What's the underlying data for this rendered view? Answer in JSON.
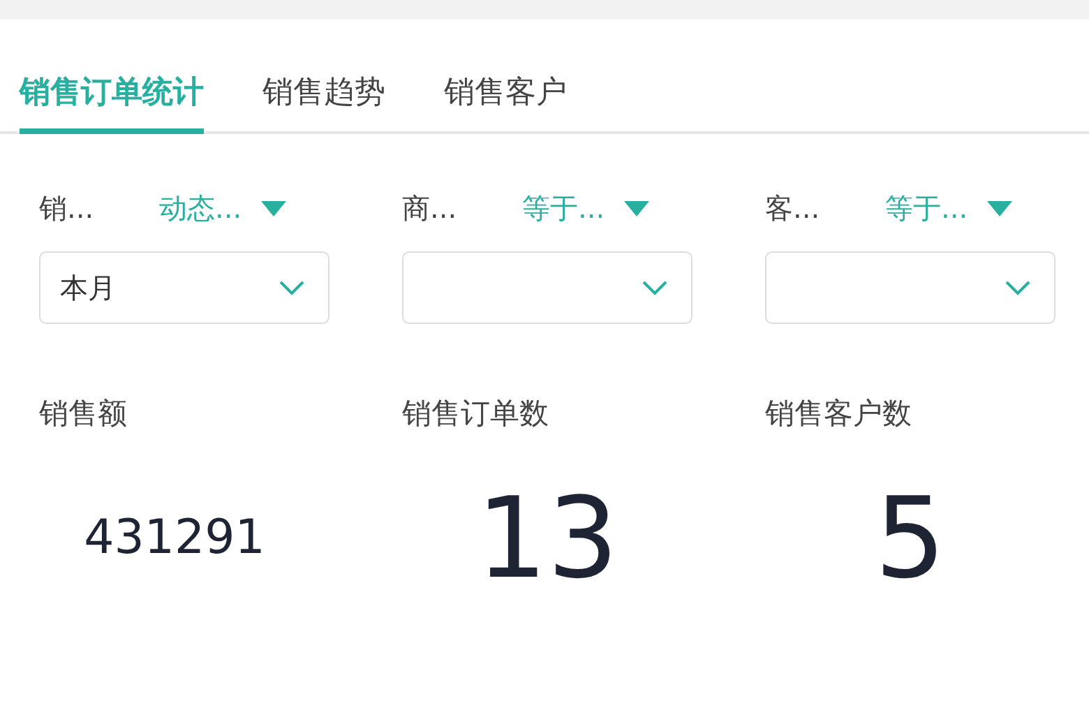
{
  "tabs": [
    {
      "label": "销售订单统计",
      "selected": true
    },
    {
      "label": "销售趋势",
      "selected": false
    },
    {
      "label": "销售客户",
      "selected": false
    }
  ],
  "filters": [
    {
      "label": "销...",
      "operator": "动态...",
      "value": "本月"
    },
    {
      "label": "商...",
      "operator": "等于..."
    },
    {
      "label": "客...",
      "operator": "等于..."
    }
  ],
  "metrics": [
    {
      "label": "销售额",
      "value": "431291",
      "kind": "compact"
    },
    {
      "label": "销售订单数",
      "value": "13",
      "kind": "large"
    },
    {
      "label": "销售客户数",
      "value": "5",
      "kind": "large"
    }
  ]
}
